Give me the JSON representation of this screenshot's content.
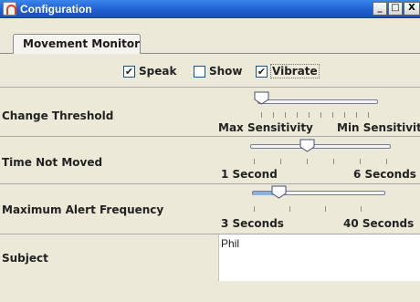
{
  "window": {
    "title": "Configuration",
    "minimize_glyph": "_",
    "maximize_glyph": "□",
    "close_glyph": "X"
  },
  "tabs": [
    {
      "label": "Movement Monitor",
      "selected": true
    }
  ],
  "checkboxes": [
    {
      "label": "Speak",
      "checked": true
    },
    {
      "label": "Show",
      "checked": false
    },
    {
      "label": "Vibrate",
      "checked": true
    }
  ],
  "change_threshold": {
    "label": "Change Threshold",
    "min_label": "Max Sensitivity",
    "max_label": "Min Sensitivity",
    "position": 0.0
  },
  "time_not_moved": {
    "label": "Time Not Moved",
    "min_label": "1 Second",
    "max_label": "6 Seconds",
    "position": 0.4
  },
  "max_alert_frequency": {
    "label": "Maximum Alert Frequency",
    "min_label": "3 Seconds",
    "max_label": "40 Seconds",
    "position": 0.2
  },
  "subject": {
    "label": "Subject",
    "value": "Phil"
  },
  "colors": {
    "titlebar": "#1f5fd0",
    "panel": "#ece9d8",
    "thumb_fill": "#ffffff",
    "thumb_border": "#4a4a7a"
  }
}
